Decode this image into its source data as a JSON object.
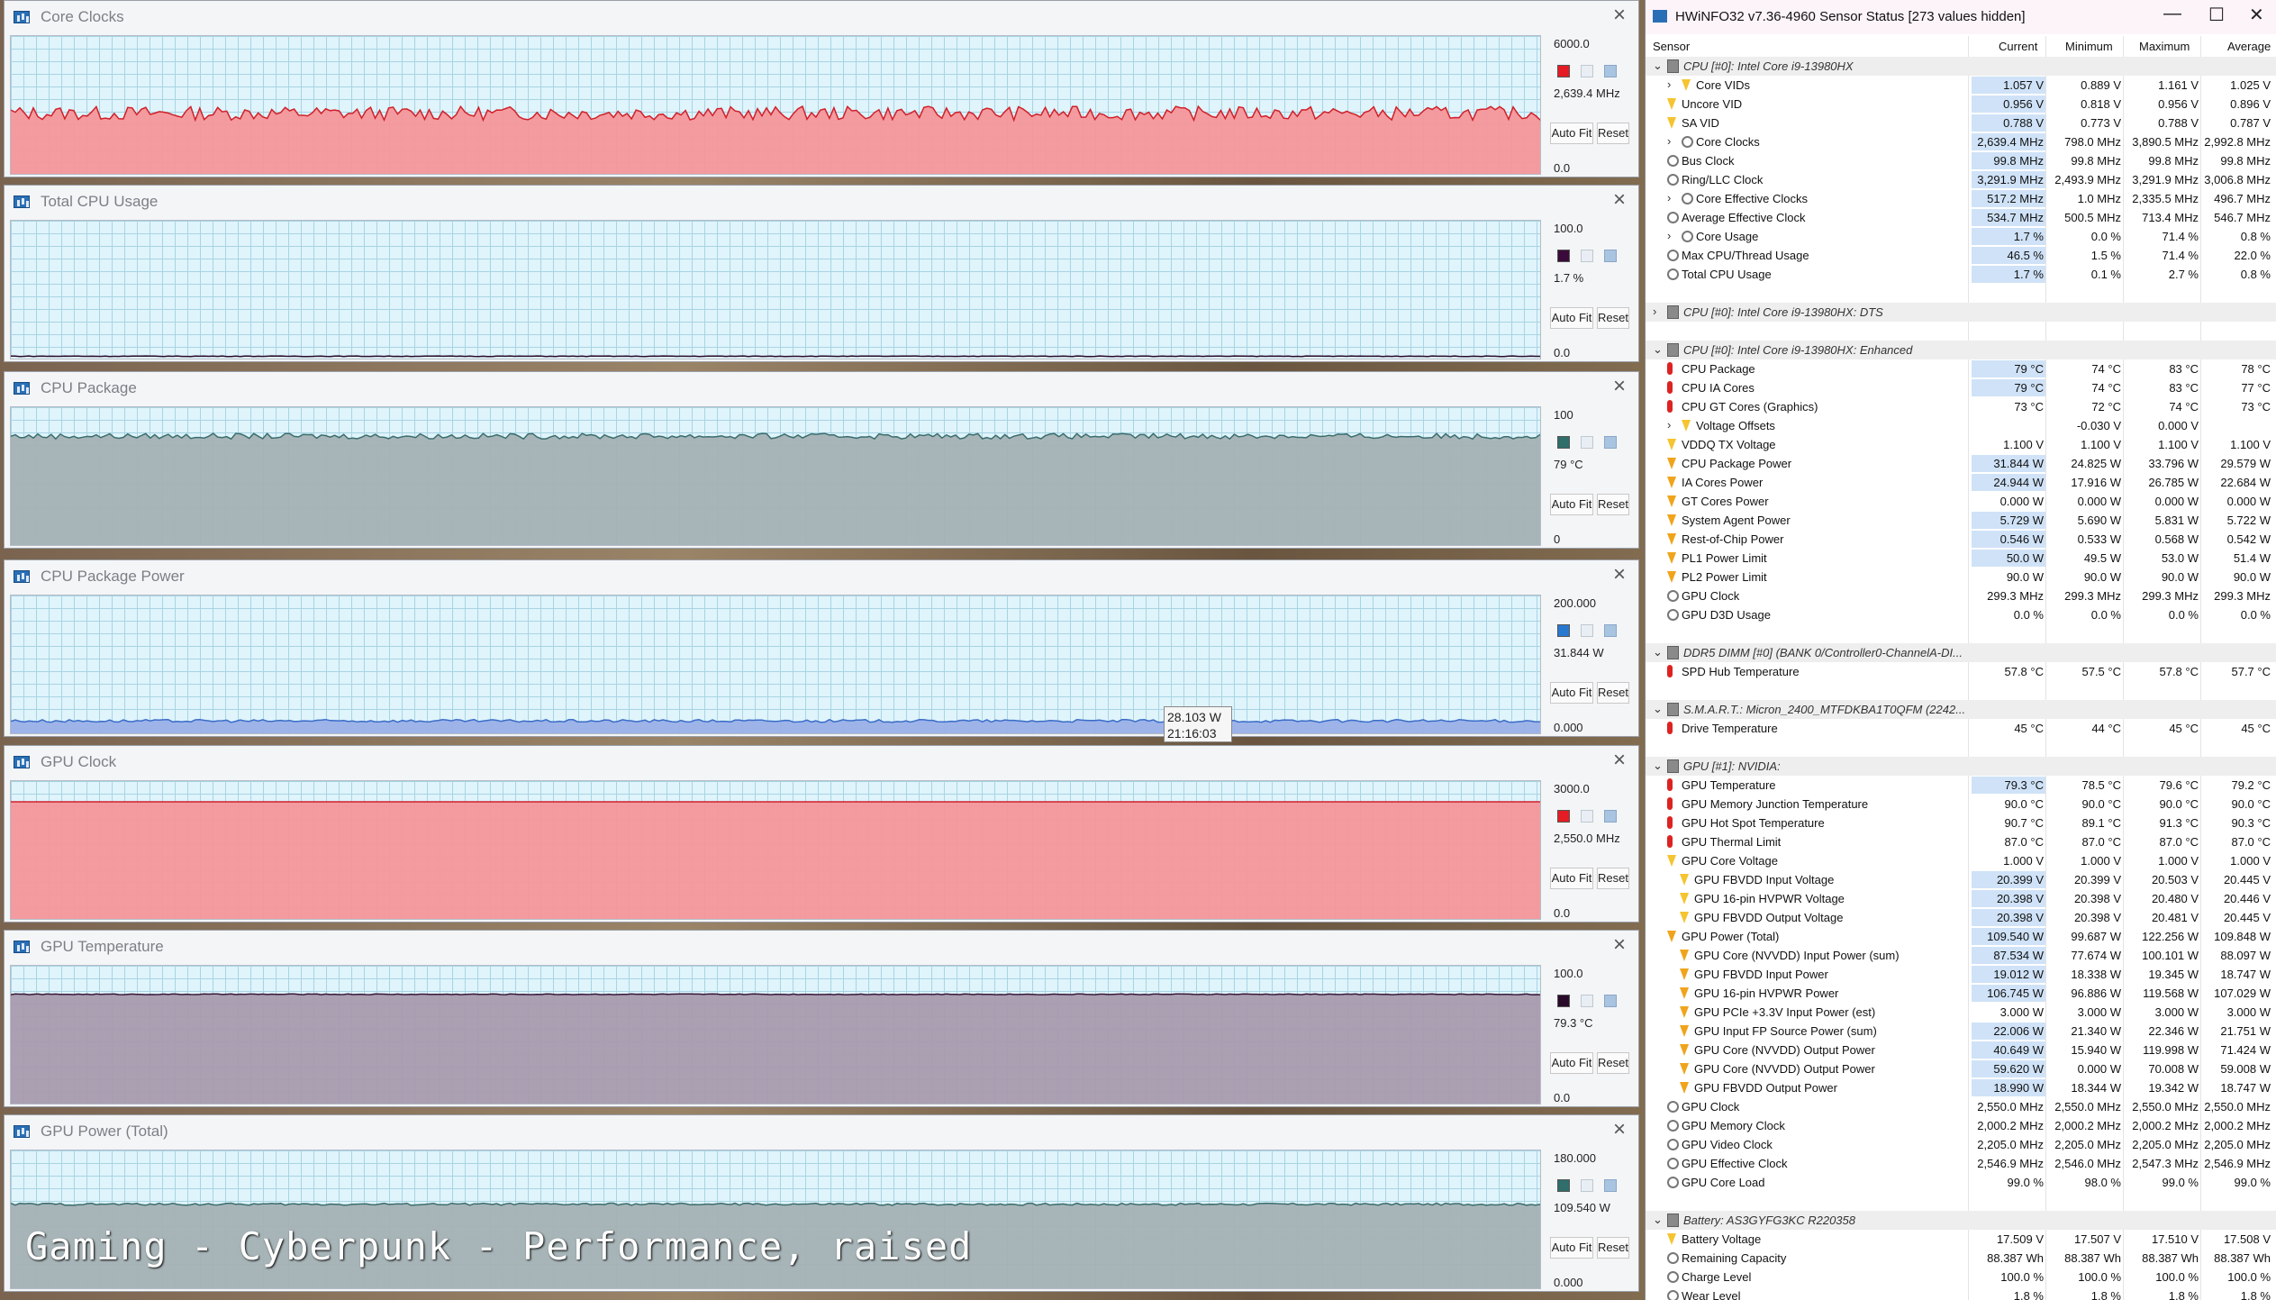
{
  "caption": "Gaming - Cyberpunk - Performance, raised",
  "tooltip": {
    "value": "28.103 W",
    "time": "21:16:03"
  },
  "graphs": [
    {
      "title": "Core Clocks",
      "max": "6000.0",
      "current": "2,639.4 MHz",
      "min": "0.0",
      "level": 0.44,
      "color": "#f4969a",
      "line": "#d0202a",
      "swatch": "#e51c23",
      "noise": 0.05
    },
    {
      "title": "Total CPU Usage",
      "max": "100.0",
      "current": "1.7 %",
      "min": "0.0",
      "level": 0.017,
      "color": "#e0f4fb",
      "line": "#2a0a2a",
      "swatch": "#3a0b3a",
      "noise": 0.002
    },
    {
      "title": "CPU Package",
      "max": "100",
      "current": "79 °C",
      "min": "0",
      "level": 0.79,
      "color": "#a4b1b4",
      "line": "#3b6e6e",
      "swatch": "#2f6e6a",
      "noise": 0.02
    },
    {
      "title": "CPU Package Power",
      "max": "200.000",
      "current": "31.844 W",
      "min": "0.000",
      "level": 0.09,
      "color": "#9ab0e8",
      "line": "#3a6cc8",
      "swatch": "#2878d0",
      "noise": 0.01
    },
    {
      "title": "GPU Clock",
      "max": "3000.0",
      "current": "2,550.0 MHz",
      "min": "0.0",
      "level": 0.85,
      "color": "#f4969a",
      "line": "#d0202a",
      "swatch": "#e51c23",
      "noise": 0.0
    },
    {
      "title": "GPU Temperature",
      "max": "100.0",
      "current": "79.3 °C",
      "min": "0.0",
      "level": 0.793,
      "color": "#a89aae",
      "line": "#3a1a3a",
      "swatch": "#2a0a2a",
      "noise": 0.003
    },
    {
      "title": "GPU Power (Total)",
      "max": "180.000",
      "current": "109.540 W",
      "min": "0.000",
      "level": 0.61,
      "color": "#a4b1b4",
      "line": "#3b6e6e",
      "swatch": "#2f6e6a",
      "noise": 0.008
    }
  ],
  "buttons": {
    "autofit": "Auto Fit",
    "reset": "Reset"
  },
  "sensor": {
    "title": "HWiNFO32 v7.36-4960 Sensor Status [273 values hidden]",
    "controls": {
      "minimize": "—",
      "maximize": "☐",
      "close": "✕"
    },
    "columns": {
      "sensor": "Sensor",
      "current": "Current",
      "minimum": "Minimum",
      "maximum": "Maximum",
      "average": "Average"
    },
    "rows": [
      {
        "type": "grp",
        "label": "CPU [#0]: Intel Core i9-13980HX",
        "exp": "v"
      },
      {
        "icon": "volt",
        "label": "Core VIDs",
        "exp": ">",
        "indent": 2,
        "c": "1.057 V",
        "mn": "0.889 V",
        "mx": "1.161 V",
        "av": "1.025 V",
        "hl": true
      },
      {
        "icon": "volt",
        "label": "Uncore VID",
        "c": "0.956 V",
        "mn": "0.818 V",
        "mx": "0.956 V",
        "av": "0.896 V",
        "hl": true
      },
      {
        "icon": "volt",
        "label": "SA VID",
        "c": "0.788 V",
        "mn": "0.773 V",
        "mx": "0.788 V",
        "av": "0.787 V",
        "hl": true
      },
      {
        "icon": "clock",
        "label": "Core Clocks",
        "exp": ">",
        "indent": 2,
        "c": "2,639.4 MHz",
        "mn": "798.0 MHz",
        "mx": "3,890.5 MHz",
        "av": "2,992.8 MHz",
        "hl": true
      },
      {
        "icon": "clock",
        "label": "Bus Clock",
        "c": "99.8 MHz",
        "mn": "99.8 MHz",
        "mx": "99.8 MHz",
        "av": "99.8 MHz",
        "hl": true
      },
      {
        "icon": "clock",
        "label": "Ring/LLC Clock",
        "c": "3,291.9 MHz",
        "mn": "2,493.9 MHz",
        "mx": "3,291.9 MHz",
        "av": "3,006.8 MHz",
        "hl": true
      },
      {
        "icon": "clock",
        "label": "Core Effective Clocks",
        "exp": ">",
        "indent": 2,
        "c": "517.2 MHz",
        "mn": "1.0 MHz",
        "mx": "2,335.5 MHz",
        "av": "496.7 MHz",
        "hl": true
      },
      {
        "icon": "clock",
        "label": "Average Effective Clock",
        "c": "534.7 MHz",
        "mn": "500.5 MHz",
        "mx": "713.4 MHz",
        "av": "546.7 MHz",
        "hl": true
      },
      {
        "icon": "clock",
        "label": "Core Usage",
        "exp": ">",
        "indent": 2,
        "c": "1.7 %",
        "mn": "0.0 %",
        "mx": "71.4 %",
        "av": "0.8 %",
        "hl": true
      },
      {
        "icon": "clock",
        "label": "Max CPU/Thread Usage",
        "c": "46.5 %",
        "mn": "1.5 %",
        "mx": "71.4 %",
        "av": "22.0 %",
        "hl": true
      },
      {
        "icon": "clock",
        "label": "Total CPU Usage",
        "c": "1.7 %",
        "mn": "0.1 %",
        "mx": "2.7 %",
        "av": "0.8 %",
        "hl": true
      },
      {
        "type": "blank"
      },
      {
        "type": "grp",
        "label": "CPU [#0]: Intel Core i9-13980HX: DTS",
        "exp": ">"
      },
      {
        "type": "blank"
      },
      {
        "type": "grp",
        "label": "CPU [#0]: Intel Core i9-13980HX: Enhanced",
        "exp": "v"
      },
      {
        "icon": "temp",
        "label": "CPU Package",
        "c": "79 °C",
        "mn": "74 °C",
        "mx": "83 °C",
        "av": "78 °C",
        "hl": true
      },
      {
        "icon": "temp",
        "label": "CPU IA Cores",
        "c": "79 °C",
        "mn": "74 °C",
        "mx": "83 °C",
        "av": "77 °C",
        "hl": true
      },
      {
        "icon": "temp",
        "label": "CPU GT Cores (Graphics)",
        "c": "73 °C",
        "mn": "72 °C",
        "mx": "74 °C",
        "av": "73 °C"
      },
      {
        "icon": "volt",
        "label": "Voltage Offsets",
        "exp": ">",
        "indent": 2,
        "c": "",
        "mn": "-0.030 V",
        "mx": "0.000 V",
        "av": ""
      },
      {
        "icon": "volt",
        "label": "VDDQ TX Voltage",
        "c": "1.100 V",
        "mn": "1.100 V",
        "mx": "1.100 V",
        "av": "1.100 V"
      },
      {
        "icon": "power",
        "label": "CPU Package Power",
        "c": "31.844 W",
        "mn": "24.825 W",
        "mx": "33.796 W",
        "av": "29.579 W",
        "hl": true
      },
      {
        "icon": "power",
        "label": "IA Cores Power",
        "c": "24.944 W",
        "mn": "17.916 W",
        "mx": "26.785 W",
        "av": "22.684 W",
        "hl": true
      },
      {
        "icon": "power",
        "label": "GT Cores Power",
        "c": "0.000 W",
        "mn": "0.000 W",
        "mx": "0.000 W",
        "av": "0.000 W"
      },
      {
        "icon": "power",
        "label": "System Agent Power",
        "c": "5.729 W",
        "mn": "5.690 W",
        "mx": "5.831 W",
        "av": "5.722 W",
        "hl": true
      },
      {
        "icon": "power",
        "label": "Rest-of-Chip Power",
        "c": "0.546 W",
        "mn": "0.533 W",
        "mx": "0.568 W",
        "av": "0.542 W",
        "hl": true
      },
      {
        "icon": "power",
        "label": "PL1 Power Limit",
        "c": "50.0 W",
        "mn": "49.5 W",
        "mx": "53.0 W",
        "av": "51.4 W",
        "hl": true
      },
      {
        "icon": "power",
        "label": "PL2 Power Limit",
        "c": "90.0 W",
        "mn": "90.0 W",
        "mx": "90.0 W",
        "av": "90.0 W"
      },
      {
        "icon": "clock",
        "label": "GPU Clock",
        "c": "299.3 MHz",
        "mn": "299.3 MHz",
        "mx": "299.3 MHz",
        "av": "299.3 MHz"
      },
      {
        "icon": "clock",
        "label": "GPU D3D Usage",
        "c": "0.0 %",
        "mn": "0.0 %",
        "mx": "0.0 %",
        "av": "0.0 %"
      },
      {
        "type": "blank"
      },
      {
        "type": "grp",
        "label": "DDR5 DIMM [#0] (BANK 0/Controller0-ChannelA-DI...",
        "exp": "v"
      },
      {
        "icon": "temp",
        "label": "SPD Hub Temperature",
        "c": "57.8 °C",
        "mn": "57.5 °C",
        "mx": "57.8 °C",
        "av": "57.7 °C"
      },
      {
        "type": "blank"
      },
      {
        "type": "grp",
        "label": "S.M.A.R.T.: Micron_2400_MTFDKBA1T0QFM (2242...",
        "exp": "v"
      },
      {
        "icon": "temp",
        "label": "Drive Temperature",
        "c": "45 °C",
        "mn": "44 °C",
        "mx": "45 °C",
        "av": "45 °C"
      },
      {
        "type": "blank"
      },
      {
        "type": "grp",
        "label": "GPU [#1]: NVIDIA:",
        "exp": "v"
      },
      {
        "icon": "temp",
        "label": "GPU Temperature",
        "c": "79.3 °C",
        "mn": "78.5 °C",
        "mx": "79.6 °C",
        "av": "79.2 °C",
        "hl": true
      },
      {
        "icon": "temp",
        "label": "GPU Memory Junction Temperature",
        "c": "90.0 °C",
        "mn": "90.0 °C",
        "mx": "90.0 °C",
        "av": "90.0 °C"
      },
      {
        "icon": "temp",
        "label": "GPU Hot Spot Temperature",
        "c": "90.7 °C",
        "mn": "89.1 °C",
        "mx": "91.3 °C",
        "av": "90.3 °C"
      },
      {
        "icon": "temp",
        "label": "GPU Thermal Limit",
        "c": "87.0 °C",
        "mn": "87.0 °C",
        "mx": "87.0 °C",
        "av": "87.0 °C"
      },
      {
        "icon": "volt",
        "label": "GPU Core Voltage",
        "c": "1.000 V",
        "mn": "1.000 V",
        "mx": "1.000 V",
        "av": "1.000 V"
      },
      {
        "icon": "volt",
        "label": "GPU FBVDD Input Voltage",
        "indent": 1,
        "c": "20.399 V",
        "mn": "20.399 V",
        "mx": "20.503 V",
        "av": "20.445 V",
        "hl": true
      },
      {
        "icon": "volt",
        "label": "GPU 16-pin HVPWR Voltage",
        "indent": 1,
        "c": "20.398 V",
        "mn": "20.398 V",
        "mx": "20.480 V",
        "av": "20.446 V",
        "hl": true
      },
      {
        "icon": "volt",
        "label": "GPU FBVDD Output Voltage",
        "indent": 1,
        "c": "20.398 V",
        "mn": "20.398 V",
        "mx": "20.481 V",
        "av": "20.445 V",
        "hl": true
      },
      {
        "icon": "power",
        "label": "GPU Power (Total)",
        "c": "109.540 W",
        "mn": "99.687 W",
        "mx": "122.256 W",
        "av": "109.848 W",
        "hl": true
      },
      {
        "icon": "power",
        "label": "GPU Core (NVVDD) Input Power (sum)",
        "indent": 1,
        "c": "87.534 W",
        "mn": "77.674 W",
        "mx": "100.101 W",
        "av": "88.097 W",
        "hl": true
      },
      {
        "icon": "power",
        "label": "GPU FBVDD Input Power",
        "indent": 1,
        "c": "19.012 W",
        "mn": "18.338 W",
        "mx": "19.345 W",
        "av": "18.747 W",
        "hl": true
      },
      {
        "icon": "power",
        "label": "GPU 16-pin HVPWR Power",
        "indent": 1,
        "c": "106.745 W",
        "mn": "96.886 W",
        "mx": "119.568 W",
        "av": "107.029 W",
        "hl": true
      },
      {
        "icon": "power",
        "label": "GPU PCIe +3.3V Input Power (est)",
        "indent": 1,
        "c": "3.000 W",
        "mn": "3.000 W",
        "mx": "3.000 W",
        "av": "3.000 W"
      },
      {
        "icon": "power",
        "label": "GPU Input FP Source Power (sum)",
        "indent": 1,
        "c": "22.006 W",
        "mn": "21.340 W",
        "mx": "22.346 W",
        "av": "21.751 W",
        "hl": true
      },
      {
        "icon": "power",
        "label": "GPU Core (NVVDD) Output Power",
        "indent": 1,
        "c": "40.649 W",
        "mn": "15.940 W",
        "mx": "119.998 W",
        "av": "71.424 W",
        "hl": true
      },
      {
        "icon": "power",
        "label": "GPU Core (NVVDD) Output Power",
        "indent": 1,
        "c": "59.620 W",
        "mn": "0.000 W",
        "mx": "70.008 W",
        "av": "59.008 W",
        "hl": true
      },
      {
        "icon": "power",
        "label": "GPU FBVDD Output Power",
        "indent": 1,
        "c": "18.990 W",
        "mn": "18.344 W",
        "mx": "19.342 W",
        "av": "18.747 W",
        "hl": true
      },
      {
        "icon": "clock",
        "label": "GPU Clock",
        "c": "2,550.0 MHz",
        "mn": "2,550.0 MHz",
        "mx": "2,550.0 MHz",
        "av": "2,550.0 MHz"
      },
      {
        "icon": "clock",
        "label": "GPU Memory Clock",
        "c": "2,000.2 MHz",
        "mn": "2,000.2 MHz",
        "mx": "2,000.2 MHz",
        "av": "2,000.2 MHz"
      },
      {
        "icon": "clock",
        "label": "GPU Video Clock",
        "c": "2,205.0 MHz",
        "mn": "2,205.0 MHz",
        "mx": "2,205.0 MHz",
        "av": "2,205.0 MHz"
      },
      {
        "icon": "clock",
        "label": "GPU Effective Clock",
        "c": "2,546.9 MHz",
        "mn": "2,546.0 MHz",
        "mx": "2,547.3 MHz",
        "av": "2,546.9 MHz"
      },
      {
        "icon": "clock",
        "label": "GPU Core Load",
        "c": "99.0 %",
        "mn": "98.0 %",
        "mx": "99.0 %",
        "av": "99.0 %"
      },
      {
        "type": "blank"
      },
      {
        "type": "grp",
        "label": "Battery: AS3GYFG3KC R220358",
        "exp": "v"
      },
      {
        "icon": "volt",
        "label": "Battery Voltage",
        "c": "17.509 V",
        "mn": "17.507 V",
        "mx": "17.510 V",
        "av": "17.508 V"
      },
      {
        "icon": "clock",
        "label": "Remaining Capacity",
        "c": "88.387 Wh",
        "mn": "88.387 Wh",
        "mx": "88.387 Wh",
        "av": "88.387 Wh"
      },
      {
        "icon": "clock",
        "label": "Charge Level",
        "c": "100.0 %",
        "mn": "100.0 %",
        "mx": "100.0 %",
        "av": "100.0 %"
      },
      {
        "icon": "clock",
        "label": "Wear Level",
        "c": "1.8 %",
        "mn": "1.8 %",
        "mx": "1.8 %",
        "av": "1.8 %"
      }
    ]
  }
}
